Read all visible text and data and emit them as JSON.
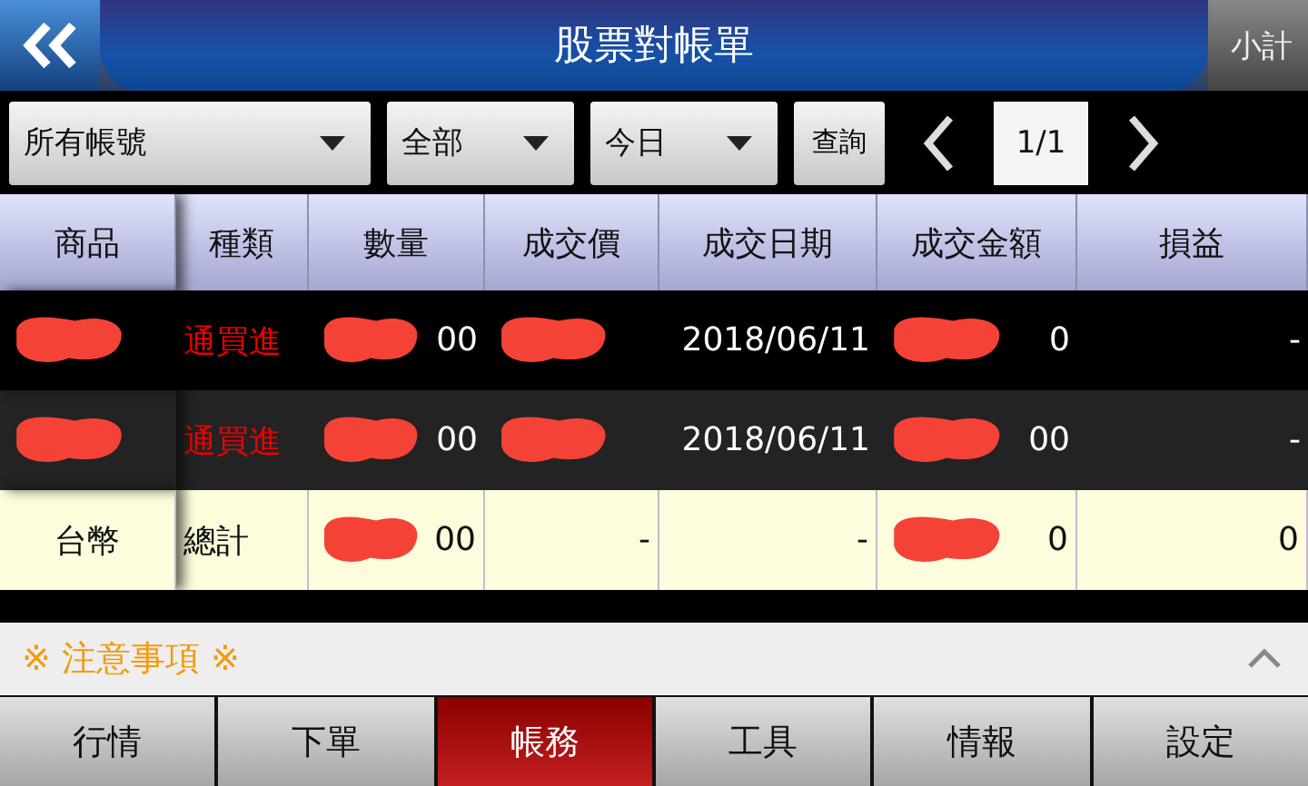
{
  "header": {
    "title": "股票對帳單",
    "right_button": "小計"
  },
  "filters": {
    "account": "所有帳號",
    "category": "全部",
    "period": "今日",
    "query_button": "查詢",
    "page": "1/1"
  },
  "table": {
    "columns": [
      "商品",
      "種類",
      "數量",
      "成交價",
      "成交日期",
      "成交金額",
      "損益"
    ],
    "rows": [
      {
        "kind": "trade",
        "cells": [
          {
            "redacted": true
          },
          {
            "text": "通買進"
          },
          {
            "text": "00",
            "redacted": true
          },
          {
            "redacted": true
          },
          {
            "text": "2018/06/11"
          },
          {
            "text": "0",
            "redacted": true
          },
          {
            "text": "-"
          }
        ]
      },
      {
        "kind": "trade",
        "cells": [
          {
            "redacted": true
          },
          {
            "text": "通買進"
          },
          {
            "text": "00",
            "redacted": true
          },
          {
            "redacted": true
          },
          {
            "text": "2018/06/11"
          },
          {
            "text": "00",
            "redacted": true
          },
          {
            "text": "-"
          }
        ]
      },
      {
        "kind": "total",
        "cells": [
          {
            "text": "台幣"
          },
          {
            "text": "總計"
          },
          {
            "text": "00",
            "redacted": true
          },
          {
            "text": "-"
          },
          {
            "text": "-"
          },
          {
            "text": "0",
            "redacted": true
          },
          {
            "text": "0"
          }
        ]
      }
    ]
  },
  "notice": {
    "title": "※ 注意事項 ※",
    "expanded": false
  },
  "tabs": [
    {
      "label": "行情",
      "selected": false
    },
    {
      "label": "下單",
      "selected": false
    },
    {
      "label": "帳務",
      "selected": true
    },
    {
      "label": "工具",
      "selected": false
    },
    {
      "label": "情報",
      "selected": false
    },
    {
      "label": "設定",
      "selected": false
    }
  ]
}
